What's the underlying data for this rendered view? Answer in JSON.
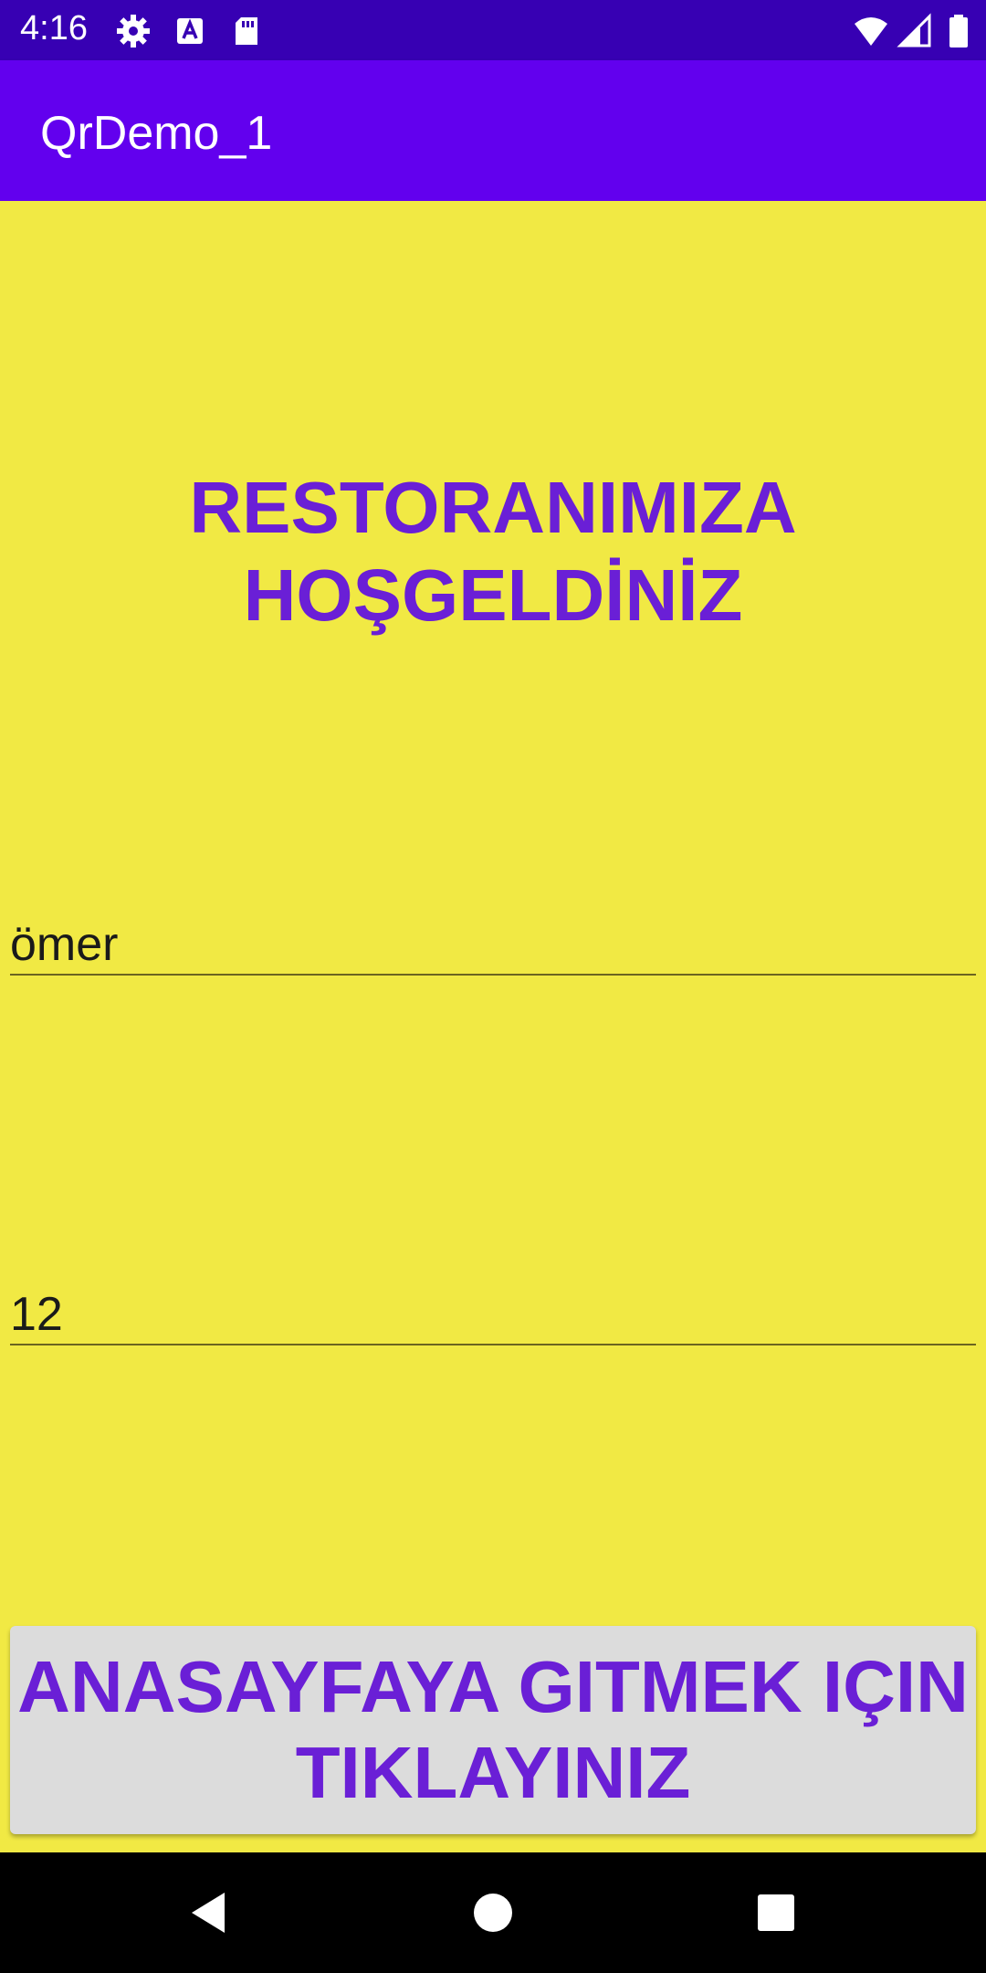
{
  "status_bar": {
    "time": "4:16",
    "icons": [
      "gear-icon",
      "font-a-icon",
      "sd-card-icon",
      "wifi-icon",
      "signal-icon",
      "battery-icon"
    ],
    "background": "#3700b3"
  },
  "app_bar": {
    "title": "QrDemo_1",
    "background": "#6200ee"
  },
  "main": {
    "background": "#f1e944",
    "welcome_line1": "RESTORANIMIZA",
    "welcome_line2": "HOŞGELDİNİZ",
    "accent_color": "#6a1fd6",
    "name_field_value": "ömer",
    "number_field_value": "12",
    "button_line1": "ANASAYFAYA GITMEK IÇIN",
    "button_line2": "TIKLAYINIZ"
  },
  "nav_bar": {
    "buttons": [
      "back-icon",
      "home-icon",
      "recents-icon"
    ]
  }
}
